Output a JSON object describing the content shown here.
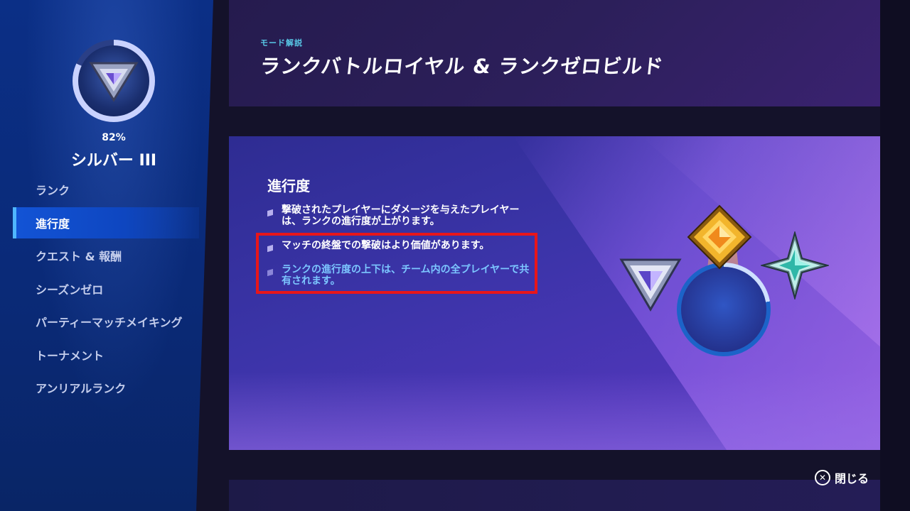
{
  "sidebar": {
    "rank_percent": "82%",
    "rank_progress": 0.82,
    "rank_name": "シルバー III",
    "items": [
      {
        "label": "ランク"
      },
      {
        "label": "進行度"
      },
      {
        "label": "クエスト & 報酬"
      },
      {
        "label": "シーズンゼロ"
      },
      {
        "label": "パーティーマッチメイキング"
      },
      {
        "label": "トーナメント"
      },
      {
        "label": "アンリアルランク"
      }
    ],
    "active_item": "進行度"
  },
  "header": {
    "subtitle": "モード解説",
    "title": "ランクバトルロイヤル & ランクゼロビルド"
  },
  "content": {
    "section_title": "進行度",
    "bullets": [
      {
        "text": "撃破されたプレイヤーにダメージを与えたプレイヤーは、ランクの進行度が上がります。",
        "color": "#ffffff"
      },
      {
        "text": "マッチの終盤での撃破はより価値があります。",
        "color": "#ffffff"
      },
      {
        "text": "ランクの進行度の上下は、チーム内の全プレイヤーで共有されます。",
        "color": "#7cc6ff"
      }
    ],
    "highlight_color": "#e8161a"
  },
  "footer": {
    "close_label": "閉じる"
  },
  "icons": {
    "rank": "silver-rank-emblem-icon",
    "close": "cross-button-icon",
    "emblems": [
      "silver-emblem-icon",
      "gold-emblem-icon",
      "platinum-emblem-icon"
    ]
  },
  "colors": {
    "sidebar": "#0b2f86",
    "active_item": "#1354d6",
    "accent_cyan": "#58c7e6"
  }
}
